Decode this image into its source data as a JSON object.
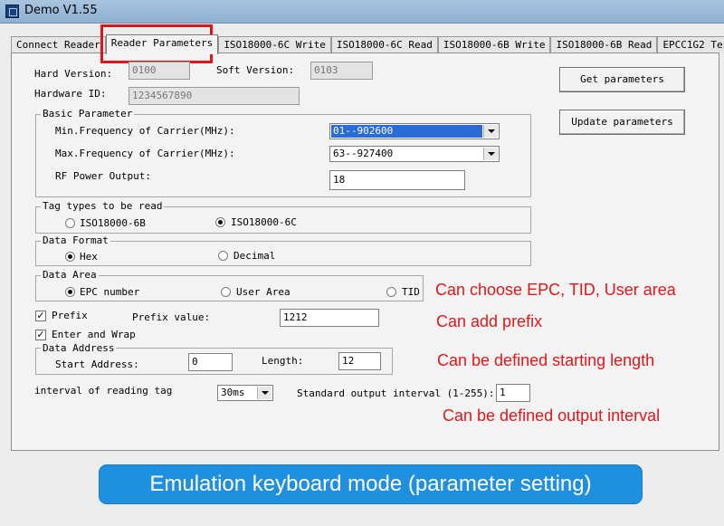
{
  "window": {
    "title": "Demo V1.55",
    "icon": "app-icon"
  },
  "tabs": [
    {
      "label": "Connect Reader",
      "active": false
    },
    {
      "label": "Reader Parameters",
      "active": true
    },
    {
      "label": "ISO18000-6C Write",
      "active": false
    },
    {
      "label": "ISO18000-6C Read",
      "active": false
    },
    {
      "label": "ISO18000-6B Write",
      "active": false
    },
    {
      "label": "ISO18000-6B Read",
      "active": false
    },
    {
      "label": "EPCC1G2 Test",
      "active": false
    }
  ],
  "info": {
    "hard_version_label": "Hard Version:",
    "hard_version_value": "0100",
    "soft_version_label": "Soft Version:",
    "soft_version_value": "0103",
    "hardware_id_label": "Hardware ID:",
    "hardware_id_value": "1234567890"
  },
  "buttons": {
    "get": "Get parameters",
    "update": "Update parameters"
  },
  "basic": {
    "title": "Basic Parameter",
    "min_label": "Min.Frequency of Carrier(MHz):",
    "min_value": "01--902600",
    "max_label": "Max.Frequency of Carrier(MHz):",
    "max_value": "63--927400",
    "rf_label": "RF Power Output:",
    "rf_value": "18"
  },
  "tag_types": {
    "title": "Tag types to be read",
    "opt1": "ISO18000-6B",
    "opt2": "ISO18000-6C",
    "selected": "ISO18000-6C"
  },
  "data_format": {
    "title": "Data Format",
    "opt1": "Hex",
    "opt2": "Decimal",
    "selected": "Hex"
  },
  "data_area": {
    "title": "Data Area",
    "opt1": "EPC number",
    "opt2": "User Area",
    "opt3": "TID",
    "selected": "EPC number"
  },
  "prefix": {
    "label": "Prefix",
    "checked": true,
    "value_label": "Prefix value:",
    "value": "1212"
  },
  "enter_wrap": {
    "label": "Enter and Wrap",
    "checked": true
  },
  "data_address": {
    "title": "Data Address",
    "start_label": "Start Address:",
    "start_value": "0",
    "length_label": "Length:",
    "length_value": "12"
  },
  "interval": {
    "label": "interval of reading tag",
    "value": "30ms",
    "output_label": "Standard output interval (1-255):",
    "output_value": "1"
  },
  "annotations": {
    "area": "Can choose EPC, TID, User area",
    "prefix": "Can add prefix",
    "length": "Can be defined starting length",
    "output": "Can be defined output interval"
  },
  "banner": "Emulation keyboard mode (parameter setting)",
  "colors": {
    "annotation": "#e2161b",
    "highlight_box": "#e0151c",
    "banner": "#1f90df",
    "selection": "#2b6bd6"
  }
}
